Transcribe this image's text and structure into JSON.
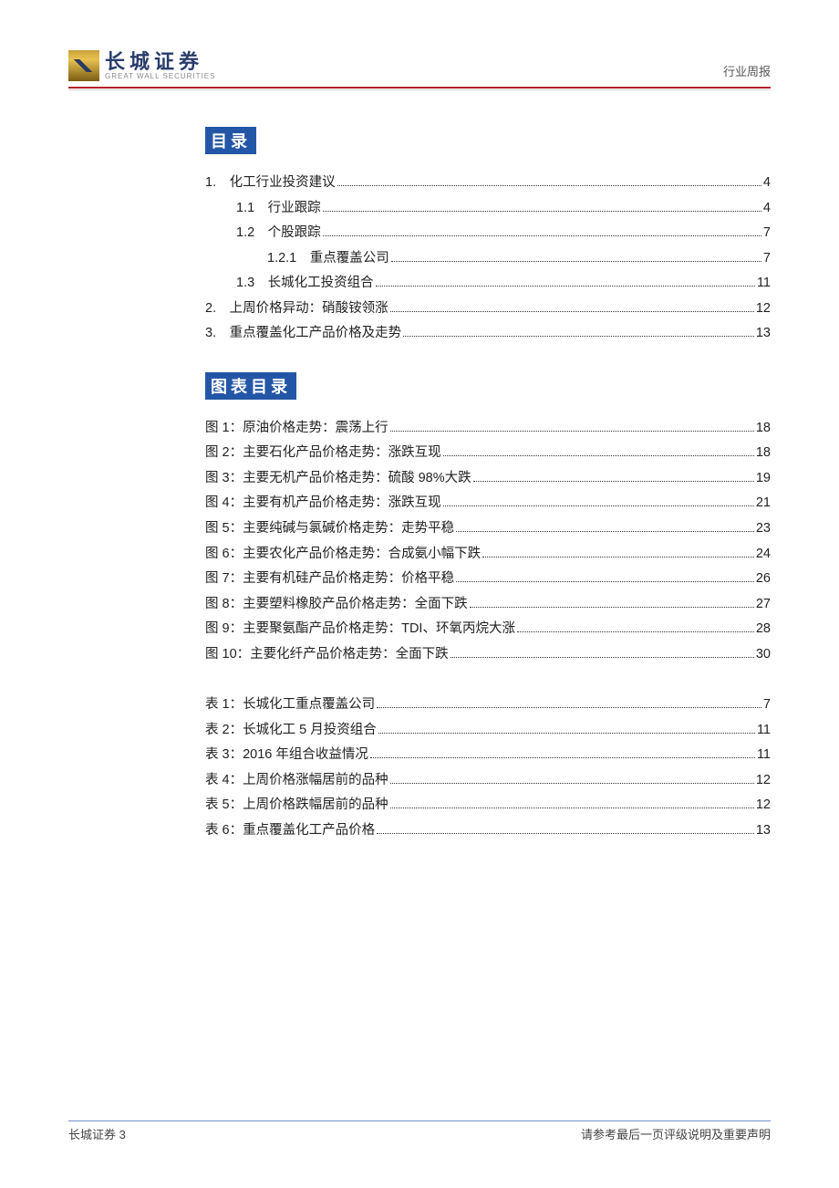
{
  "header": {
    "brand_cn": "长城证券",
    "brand_en": "GREAT WALL SECURITIES",
    "right": "行业周报"
  },
  "sections": {
    "toc_title": "目录",
    "fig_title": "图表目录"
  },
  "toc": [
    {
      "indent": 0,
      "label": "1.　化工行业投资建议",
      "page": "4"
    },
    {
      "indent": 1,
      "label": "1.1　行业跟踪",
      "page": "4"
    },
    {
      "indent": 1,
      "label": "1.2　个股跟踪",
      "page": "7"
    },
    {
      "indent": 2,
      "label": "1.2.1　重点覆盖公司",
      "page": "7"
    },
    {
      "indent": 1,
      "label": "1.3　长城化工投资组合",
      "page": "11"
    },
    {
      "indent": 0,
      "label": "2.　上周价格异动：硝酸铵领涨",
      "page": "12"
    },
    {
      "indent": 0,
      "label": "3.　重点覆盖化工产品价格及走势",
      "page": "13"
    }
  ],
  "figures": [
    {
      "label": "图 1：原油价格走势：震荡上行",
      "page": "18"
    },
    {
      "label": "图 2：主要石化产品价格走势：涨跌互现",
      "page": "18"
    },
    {
      "label": "图 3：主要无机产品价格走势：硫酸 98%大跌",
      "page": "19"
    },
    {
      "label": "图 4：主要有机产品价格走势：涨跌互现",
      "page": "21"
    },
    {
      "label": "图 5：主要纯碱与氯碱价格走势：走势平稳",
      "page": "23"
    },
    {
      "label": "图 6：主要农化产品价格走势：合成氨小幅下跌",
      "page": "24"
    },
    {
      "label": "图 7：主要有机硅产品价格走势：价格平稳",
      "page": "26"
    },
    {
      "label": "图 8：主要塑料橡胶产品价格走势：全面下跌",
      "page": "27"
    },
    {
      "label": "图 9：主要聚氨酯产品价格走势：TDI、环氧丙烷大涨",
      "page": "28"
    },
    {
      "label": "图 10：主要化纤产品价格走势：全面下跌",
      "page": "30"
    }
  ],
  "tables": [
    {
      "label": "表 1：长城化工重点覆盖公司",
      "page": "7"
    },
    {
      "label": "表 2：长城化工 5 月投资组合",
      "page": "11"
    },
    {
      "label": "表 3：2016 年组合收益情况",
      "page": "11"
    },
    {
      "label": "表 4：上周价格涨幅居前的品种",
      "page": "12"
    },
    {
      "label": "表 5：上周价格跌幅居前的品种",
      "page": "12"
    },
    {
      "label": "表 6：重点覆盖化工产品价格",
      "page": "13"
    }
  ],
  "footer": {
    "left": "长城证券 3",
    "right": "请参考最后一页评级说明及重要声明"
  }
}
